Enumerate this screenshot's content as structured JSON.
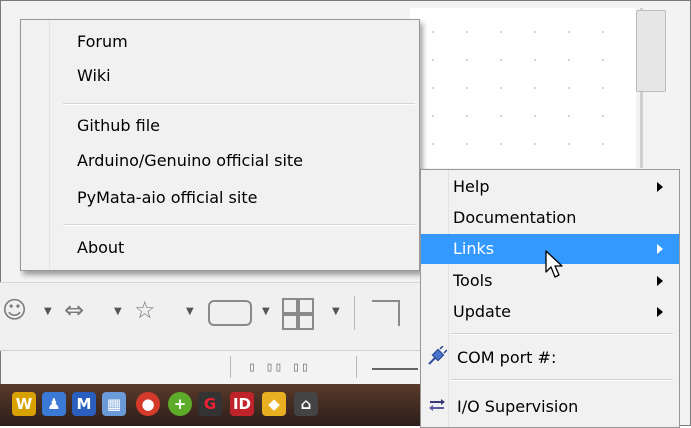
{
  "submenu": {
    "items": [
      {
        "label": "Forum"
      },
      {
        "label": "Wiki"
      },
      {
        "label": "Github file"
      },
      {
        "label": "Arduino/Genuino official site"
      },
      {
        "label": "PyMata-aio official site"
      },
      {
        "label": "About"
      }
    ]
  },
  "context_menu": {
    "items": [
      {
        "label": "Help",
        "submenu": true
      },
      {
        "label": "Documentation",
        "submenu": false
      },
      {
        "label": "Links",
        "submenu": true,
        "highlighted": true
      },
      {
        "label": "Tools",
        "submenu": true
      },
      {
        "label": "Update",
        "submenu": true
      },
      {
        "label": "COM port #:",
        "icon": "plug-icon"
      },
      {
        "label": "I/O Supervision",
        "icon": "io-supervision-icon"
      }
    ]
  },
  "toolbar": {
    "icons": [
      "smiley-icon",
      "double-arrow-icon",
      "star-icon",
      "speech-bubble-icon",
      "grid-icon",
      "shape-icon"
    ]
  },
  "colors": {
    "highlight": "#3399ff",
    "menu_bg": "#f1f1f1"
  }
}
